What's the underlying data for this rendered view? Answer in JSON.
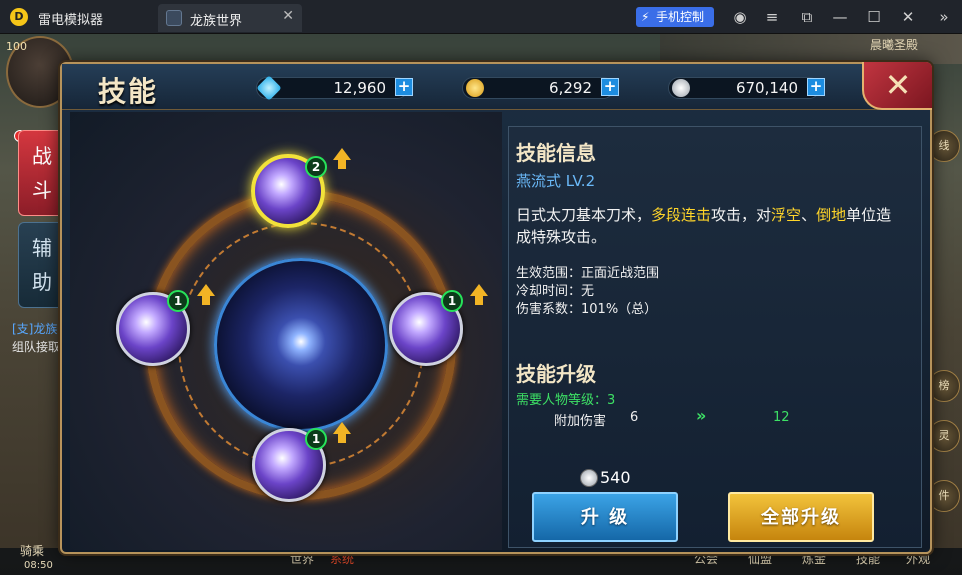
{
  "emulator": {
    "app_name": "雷电模拟器",
    "tab_title": "龙族世界",
    "tab_close": "✕",
    "phone_control": "手机控制"
  },
  "game_hud": {
    "level": "100",
    "side_tabs": {
      "battle": "战\n斗",
      "assist": "辅\n助"
    },
    "chat_lines": [
      "[支]龙族",
      "组队接取"
    ],
    "bottom_texts": [
      "骑乘",
      "08:50",
      "世界",
      "系统",
      "公会",
      "仙盟",
      "炼金",
      "技能",
      "外观"
    ],
    "top_right_text": "晨曦圣殿",
    "right_icons": [
      "榜",
      "灵",
      "件",
      "线"
    ]
  },
  "panel": {
    "title": "技能",
    "resources": [
      {
        "icon": "diamond-icon",
        "value": "12,960",
        "color": "#3cc7ff"
      },
      {
        "icon": "gold-coin-icon",
        "value": "6,292",
        "color": "#f0b62a"
      },
      {
        "icon": "silver-coin-icon",
        "value": "670,140",
        "color": "#cfd4da"
      }
    ],
    "plus": "+",
    "close": "✕"
  },
  "skills": [
    {
      "id": "top",
      "level": "2",
      "selected": true
    },
    {
      "id": "left",
      "level": "1",
      "selected": false
    },
    {
      "id": "right",
      "level": "1",
      "selected": false
    },
    {
      "id": "bottom",
      "level": "1",
      "selected": false
    }
  ],
  "info": {
    "section_title": "技能信息",
    "skill_name": "燕流式 LV.2",
    "desc_parts": [
      "日式太刀基本刀术，",
      "多段连击",
      "攻击，对",
      "浮空",
      "、",
      "倒地",
      "单位造成特殊攻击。"
    ],
    "stats": [
      {
        "label": "生效范围：",
        "value": "正面近战范围"
      },
      {
        "label": "冷却时间：",
        "value": "无"
      },
      {
        "label": "伤害系数：",
        "value": "101%（总）"
      }
    ],
    "upgrade_title": "技能升级",
    "requirement": "需要人物等级：3",
    "extra_damage_label": "附加伤害",
    "extra_damage_current": "6",
    "extra_damage_next": "12",
    "arrow": "»",
    "cost": "540",
    "upgrade_button": "升 级",
    "upgrade_all_button": "全部升级"
  }
}
